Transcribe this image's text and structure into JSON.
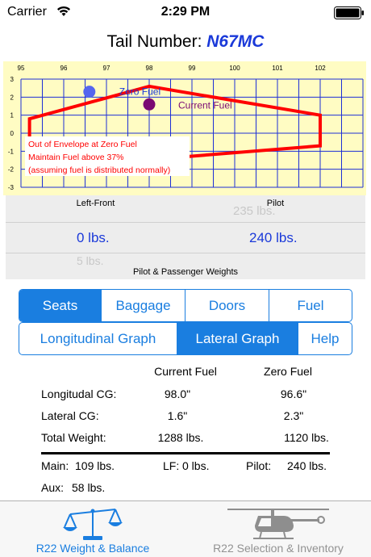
{
  "status_bar": {
    "carrier": "Carrier",
    "time": "2:29 PM"
  },
  "header": {
    "tail_label": "Tail Number:",
    "tail_value": "N67MC"
  },
  "chart_data": {
    "type": "scatter",
    "x_ticks": [
      "95",
      "96",
      "97",
      "98",
      "99",
      "100",
      "101",
      "102"
    ],
    "y_ticks": [
      "3",
      "2",
      "1",
      "0",
      "-1",
      "-2",
      "-3"
    ],
    "xlim": [
      95,
      103
    ],
    "ylim": [
      -3,
      3
    ],
    "grid": true,
    "envelope": {
      "color": "#ff0000",
      "points": [
        [
          95.2,
          -0.3
        ],
        [
          95.2,
          0.8
        ],
        [
          98.0,
          2.6
        ],
        [
          102.0,
          1.0
        ],
        [
          102.0,
          -0.7
        ],
        [
          95.2,
          -2.0
        ]
      ]
    },
    "points": [
      {
        "name": "Zero Fuel",
        "x": 96.6,
        "y": 2.3,
        "color": "#5566ee",
        "label_color": "#1a39d9"
      },
      {
        "name": "Current Fuel",
        "x": 98.0,
        "y": 1.6,
        "color": "#7a0a73",
        "label_color": "#7a0a73"
      }
    ],
    "annotation": {
      "lines": [
        "Out of Envelope at Zero Fuel",
        "Maintain Fuel above 37%",
        "(assuming fuel is distributed normally)"
      ],
      "color": "#ff0000"
    }
  },
  "picker": {
    "left_header": "Left-Front",
    "right_header": "Pilot",
    "left_selected": "0 lbs.",
    "right_selected": "240 lbs.",
    "left_below": "5 lbs.",
    "right_above": "235 lbs.",
    "footer": "Pilot & Passenger Weights"
  },
  "tabs_row1": [
    "Seats",
    "Baggage",
    "Doors",
    "Fuel"
  ],
  "tabs_row2": [
    "Longitudinal Graph",
    "Lateral Graph",
    "Help"
  ],
  "results": {
    "col_current": "Current Fuel",
    "col_zero": "Zero Fuel",
    "rows": [
      {
        "label": "Longitudal CG:",
        "current": "98.0\"",
        "zero": "96.6\""
      },
      {
        "label": "Lateral CG:",
        "current": "1.6\"",
        "zero": "2.3\""
      },
      {
        "label": "Total Weight:",
        "current": "1288 lbs.",
        "zero": "1120 lbs."
      }
    ],
    "main_label": "Main:",
    "main_value": "109 lbs.",
    "lf_label": "LF:",
    "lf_value": "0 lbs.",
    "pilot_label": "Pilot:",
    "pilot_value": "240 lbs.",
    "aux_label": "Aux:",
    "aux_value": "58 lbs."
  },
  "tab_bar": {
    "left_label": "R22 Weight & Balance",
    "right_label": "R22 Selection & Inventory",
    "left_icon": "balance-scale-icon",
    "right_icon": "helicopter-icon"
  }
}
